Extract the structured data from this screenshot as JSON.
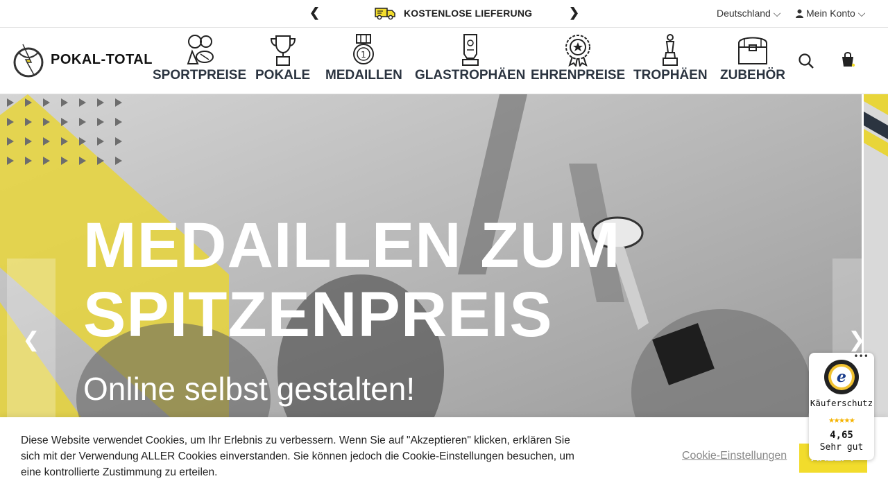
{
  "topbar": {
    "prev_arrow": "❮",
    "next_arrow": "❯",
    "promo": "KOSTENLOSE LIEFERUNG",
    "language": "Deutschland ⌵",
    "account": "Mein Konto ⌵"
  },
  "brand": {
    "name": "POKAL-TOTAL",
    "accent": "#f2dc2c"
  },
  "nav": {
    "items": [
      {
        "label": "SPORTPREISE",
        "icon": "sports-equipment-icon"
      },
      {
        "label": "POKALE",
        "icon": "cup-trophy-icon"
      },
      {
        "label": "MEDAILLEN",
        "icon": "medal-icon"
      },
      {
        "label": "GLASTROPHÄEN",
        "icon": "glass-trophy-icon"
      },
      {
        "label": "EHRENPREISE",
        "icon": "rosette-award-icon"
      },
      {
        "label": "TROPHÄEN",
        "icon": "trophy-figure-icon"
      },
      {
        "label": "ZUBEHÖR",
        "icon": "accessory-box-icon"
      }
    ]
  },
  "hero": {
    "title_line1": "MEDAILLEN ZUM",
    "title_line2": "SPITZENPREIS",
    "subtitle": "Online selbst gestalten!",
    "prev": "❮",
    "next": "❯"
  },
  "cookie": {
    "text": "Diese Website verwendet Cookies, um Ihr Erlebnis zu verbessern. Wenn Sie auf \"Akzeptieren\" klicken, erklären Sie sich mit der Verwendung ALLER Cookies einverstanden. Sie können jedoch die Cookie-Einstellungen besuchen, um eine kontrollierte Zustimmung zu erteilen.",
    "settings_label": "Cookie-Einstellungen",
    "accept_label": "AKZEPT"
  },
  "trust": {
    "dots": "•••",
    "label": "Käuferschutz",
    "stars": "★★★★★",
    "score": "4,65",
    "rating": "Sehr gut"
  }
}
